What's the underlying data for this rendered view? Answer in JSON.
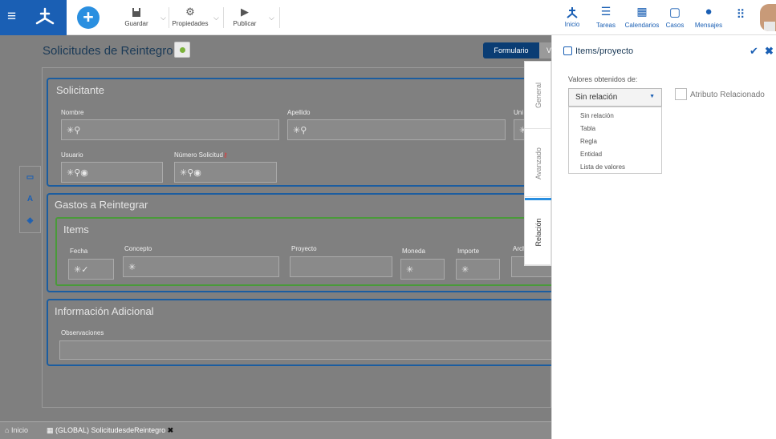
{
  "toolbar": {
    "save": "Guardar",
    "properties": "Propiedades",
    "publish": "Publicar"
  },
  "nav": {
    "home": "Inicio",
    "tasks": "Tareas",
    "calendars": "Calendarios",
    "cases": "Casos",
    "messages": "Mensajes"
  },
  "form": {
    "title": "Solicitudes de Reintegro",
    "mode_active": "Formulario",
    "mode_other": "V"
  },
  "solicitante": {
    "title": "Solicitante",
    "nombre": "Nombre",
    "apellido": "Apellido",
    "uni": "Uni",
    "usuario": "Usuario",
    "numero": "Número Solicitud"
  },
  "gastos": {
    "title": "Gastos a Reintegrar",
    "items_title": "Items",
    "fecha": "Fecha",
    "concepto": "Concepto",
    "proyecto": "Proyecto",
    "moneda": "Moneda",
    "importe": "Importe",
    "arch": "Arch"
  },
  "adicional": {
    "title": "Información Adicional",
    "obs": "Observaciones"
  },
  "glyphs": {
    "star_link": "✳⚲",
    "star_link_eye": "✳⚲◉",
    "star_check": "✳✓",
    "star": "✳"
  },
  "vtabs": [
    "General",
    "Avanzado",
    "Relación"
  ],
  "panel": {
    "title": "Items/proyecto",
    "values_label": "Valores obtenidos de:",
    "selected": "Sin relación",
    "options": [
      "Sin relación",
      "Tabla",
      "Regla",
      "Entidad",
      "Lista de valores"
    ],
    "attr": "Atributo Relacionado"
  },
  "bottom": {
    "home": "Inicio",
    "tab": "(GLOBAL) SolicitudesdeReintegro"
  },
  "colors": {
    "brand": "#1a5fb4",
    "accent": "#2a8fe0"
  }
}
